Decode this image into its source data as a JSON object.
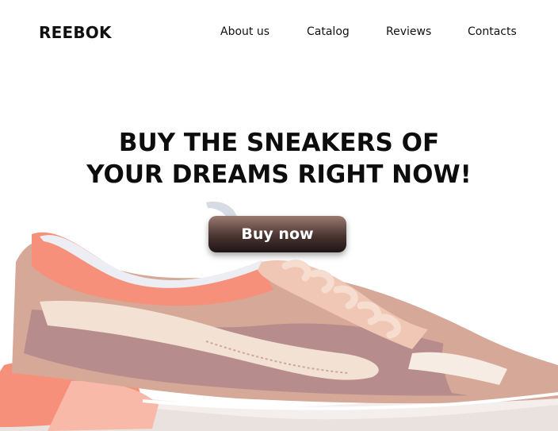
{
  "header": {
    "logo": "REEBOK",
    "nav": [
      {
        "label": "About us"
      },
      {
        "label": "Catalog"
      },
      {
        "label": "Reviews"
      },
      {
        "label": "Contacts"
      }
    ]
  },
  "hero": {
    "title_line1": "BUY THE SNEAKERS OF",
    "title_line2": "YOUR DREAMS RIGHT NOW!",
    "cta_label": "Buy now"
  },
  "image": {
    "subject": "sneaker-photo",
    "colors": {
      "coral": "#f6907a",
      "suede": "#d6a898",
      "cream": "#f3e1d3",
      "mauve": "#b78c8c",
      "sole": "#f4efec",
      "button_dark": "#2a1d1b"
    }
  }
}
